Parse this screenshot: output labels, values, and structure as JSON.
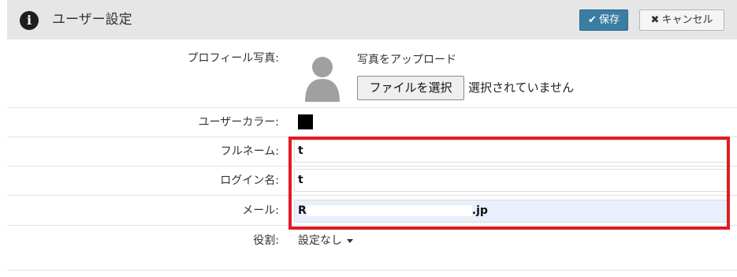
{
  "header": {
    "title": "ユーザー設定",
    "info_icon": "i",
    "save_label": "保存",
    "save_icon": "✔",
    "cancel_label": "キャンセル",
    "cancel_icon": "✖",
    "colors": {
      "background": "#e6e6e6",
      "save_button": "#3a7da2"
    }
  },
  "form": {
    "photo": {
      "label": "プロフィール写真:",
      "caption": "写真をアップロード",
      "file_button": "ファイルを選択",
      "file_status": "選択されていません",
      "avatar_icon": "user-silhouette-icon"
    },
    "color": {
      "label": "ユーザーカラー:",
      "value": "#000000"
    },
    "fullname": {
      "label": "フルネーム:",
      "value": "t"
    },
    "login": {
      "label": "ログイン名:",
      "value": "t"
    },
    "email": {
      "label": "メール:",
      "value_start": "R",
      "value_end": ".jp"
    },
    "role": {
      "label": "役割:",
      "value": "設定なし"
    }
  },
  "highlight": {
    "color": "#e01b24"
  }
}
